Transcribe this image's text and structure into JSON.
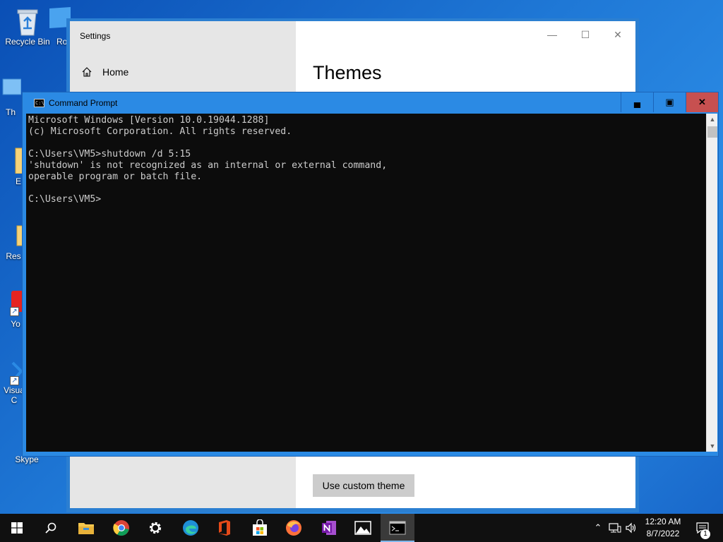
{
  "desktop": {
    "icons": [
      {
        "label": "Recycle Bin"
      },
      {
        "label": "Ro"
      },
      {
        "label": "Th"
      },
      {
        "label": "E"
      },
      {
        "label": "Res"
      },
      {
        "label": "Yo"
      },
      {
        "label": "Visua\nC"
      },
      {
        "label": "Skype"
      }
    ]
  },
  "settings": {
    "app_title": "Settings",
    "home_label": "Home",
    "page_title": "Themes",
    "custom_theme_button": "Use custom theme"
  },
  "cmd": {
    "title": "Command Prompt",
    "lines": [
      "Microsoft Windows [Version 10.0.19044.1288]",
      "(c) Microsoft Corporation. All rights reserved.",
      "",
      "C:\\Users\\VM5>shutdown /d 5:15",
      "'shutdown' is not recognized as an internal or external command,",
      "operable program or batch file.",
      "",
      "C:\\Users\\VM5>"
    ]
  },
  "taskbar": {
    "apps": [
      "start",
      "search",
      "file-explorer",
      "chrome",
      "settings",
      "edge",
      "office",
      "store",
      "firefox",
      "onenote",
      "photos",
      "command-prompt"
    ],
    "clock_time": "12:20 AM",
    "clock_date": "8/7/2022",
    "notification_count": "1"
  },
  "colors": {
    "desktop_accent": "#1f78d6",
    "cmd_titlebar": "#2b8ae4",
    "cmd_close": "#c75050",
    "console_bg": "#0c0c0c",
    "console_fg": "#cccccc",
    "taskbar_bg": "#101010"
  }
}
